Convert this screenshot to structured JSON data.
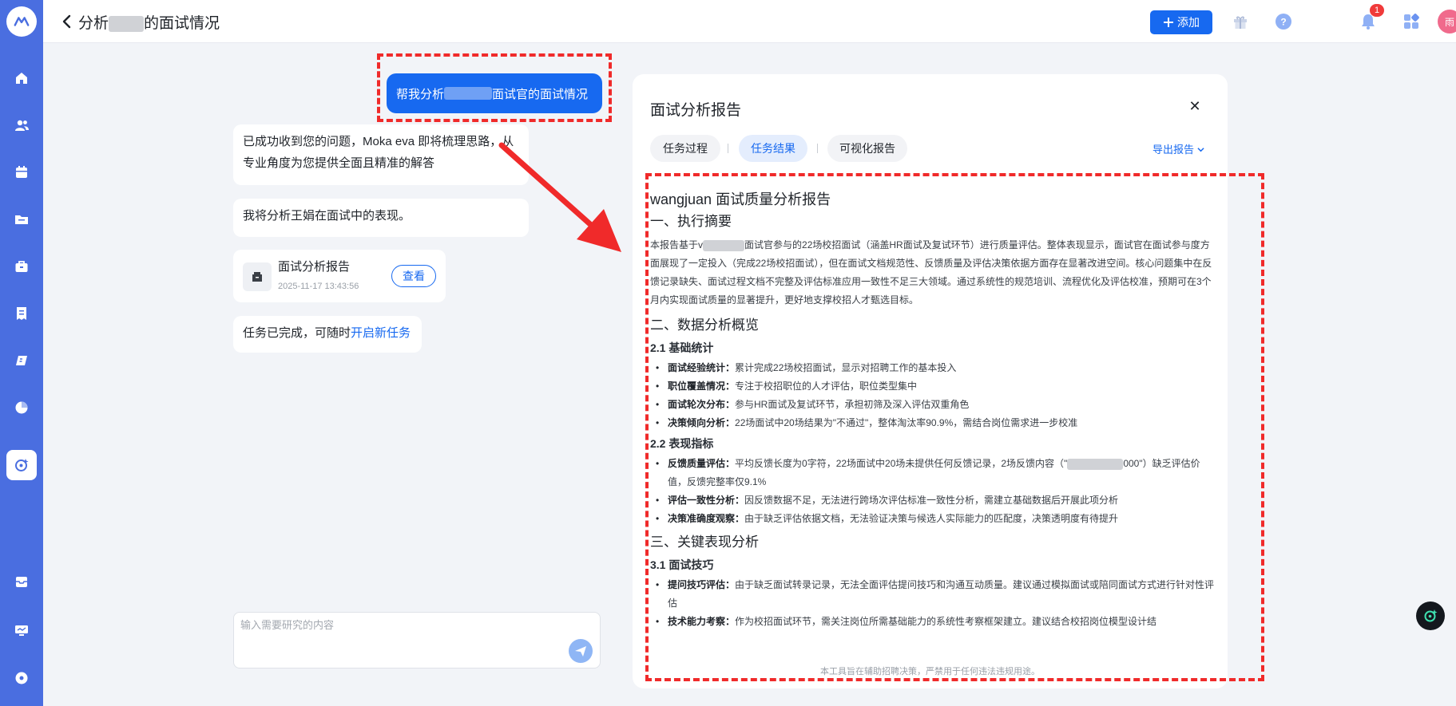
{
  "header": {
    "title_prefix": "分析",
    "title_suffix": "的面试情况",
    "add_label": "添加",
    "notification_count": "1",
    "avatar_text": "雨"
  },
  "sidebar": {
    "items": [
      {
        "icon": "home-icon"
      },
      {
        "icon": "people-icon"
      },
      {
        "icon": "calendar-icon"
      },
      {
        "icon": "folder-icon"
      },
      {
        "icon": "briefcase-icon"
      },
      {
        "icon": "receipt-icon"
      },
      {
        "icon": "book-icon"
      },
      {
        "icon": "pie-chart-icon"
      },
      {
        "icon": "ai-assistant-icon"
      },
      {
        "icon": "inbox-icon"
      },
      {
        "icon": "monitor-icon"
      },
      {
        "icon": "disc-icon"
      }
    ]
  },
  "chat": {
    "user_message_prefix": "帮我分析",
    "user_message_suffix": "面试官的面试情况",
    "reply1": "已成功收到您的问题，Moka eva 即将梳理思路，从专业角度为您提供全面且精准的解答",
    "reply2": "我将分析王娟在面试中的表现。",
    "card_title": "面试分析报告",
    "card_time": "2025-11-17 13:43:56",
    "view_label": "查看",
    "done_text": "任务已完成，可随时",
    "done_link": "开启新任务",
    "input_placeholder": "输入需要研究的内容"
  },
  "panel": {
    "title": "面试分析报告",
    "tabs": [
      "任务过程",
      "任务结果",
      "可视化报告"
    ],
    "active_tab": "任务结果",
    "export_label": "导出报告",
    "footer": "本工具旨在辅助招聘决策，严禁用于任何违法违规用途。"
  },
  "report": {
    "title": "wangjuan 面试质量分析报告",
    "s1_heading": "一、执行摘要",
    "s1_body_prefix": "本报告基于v",
    "s1_body": "面试官参与的22场校招面试（涵盖HR面试及复试环节）进行质量评估。整体表现显示，面试官在面试参与度方面展现了一定投入（完成22场校招面试），但在面试文档规范性、反馈质量及评估决策依据方面存在显著改进空间。核心问题集中在反馈记录缺失、面试过程文档不完整及评估标准应用一致性不足三大领域。通过系统性的规范培训、流程优化及评估校准，预期可在3个月内实现面试质量的显著提升，更好地支撑校招人才甄选目标。",
    "s2_heading": "二、数据分析概览",
    "s21_heading": "2.1 基础统计",
    "s21_items": [
      {
        "label": "面试经验统计：",
        "text": "累计完成22场校招面试，显示对招聘工作的基本投入"
      },
      {
        "label": "职位覆盖情况：",
        "text": "专注于校招职位的人才评估，职位类型集中"
      },
      {
        "label": "面试轮次分布：",
        "text": "参与HR面试及复试环节，承担初筛及深入评估双重角色"
      },
      {
        "label": "决策倾向分析：",
        "text": "22场面试中20场结果为\"不通过\"，整体淘汰率90.9%，需结合岗位需求进一步校准"
      }
    ],
    "s22_heading": "2.2 表现指标",
    "s22_item1_label": "反馈质量评估：",
    "s22_item1_text_a": "平均反馈长度为0字符，22场面试中20场未提供任何反馈记录，2场反馈内容（\"",
    "s22_item1_text_b": "000\"）缺乏评估价值，反馈完整率仅9.1%",
    "s22_items": [
      {
        "label": "评估一致性分析：",
        "text": "因反馈数据不足，无法进行跨场次评估标准一致性分析，需建立基础数据后开展此项分析"
      },
      {
        "label": "决策准确度观察：",
        "text": "由于缺乏评估依据文档，无法验证决策与候选人实际能力的匹配度，决策透明度有待提升"
      }
    ],
    "s3_heading": "三、关键表现分析",
    "s31_heading": "3.1 面试技巧",
    "s31_items": [
      {
        "label": "提问技巧评估：",
        "text": "由于缺乏面试转录记录，无法全面评估提问技巧和沟通互动质量。建议通过模拟面试或陪同面试方式进行针对性评估"
      },
      {
        "label": "技术能力考察：",
        "text": "作为校招面试环节，需关注岗位所需基础能力的系统性考察框架建立。建议结合校招岗位模型设计结"
      }
    ]
  }
}
